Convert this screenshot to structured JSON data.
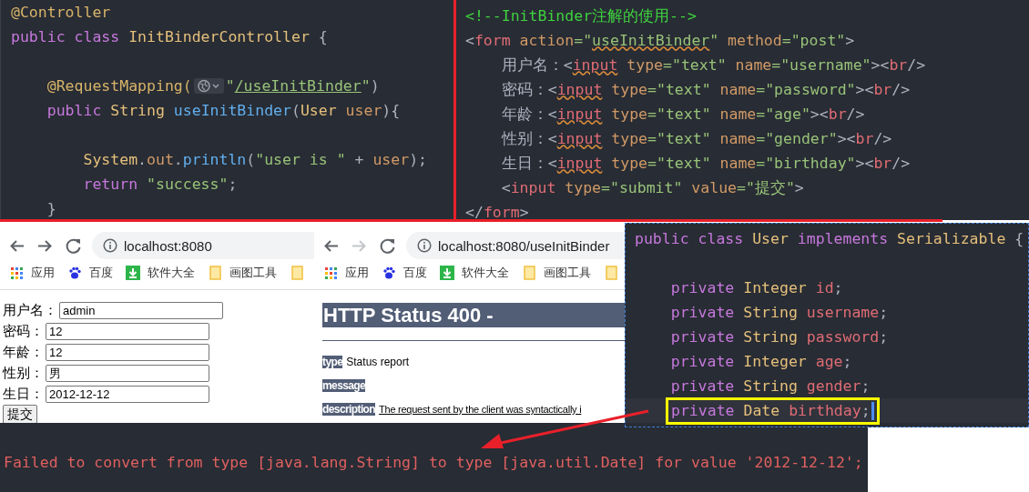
{
  "controller_code": {
    "lines": [
      {
        "tokens": [
          {
            "text": "@Controller",
            "kind": "ann"
          }
        ]
      },
      {
        "tokens": [
          {
            "text": "public",
            "kind": "kw"
          },
          {
            "text": " class",
            "kind": "kw"
          },
          {
            "text": " InitBinderController",
            "kind": "type"
          },
          {
            "text": " {",
            "kind": "plain"
          }
        ]
      },
      {
        "blank_before": true,
        "tokens": [
          {
            "text": "    @RequestMapping(",
            "kind": "ann",
            "inlay": true
          },
          {
            "text": "\"",
            "kind": "str"
          },
          {
            "text": "/useInitBinder",
            "kind": "url"
          },
          {
            "text": "\"",
            "kind": "str"
          },
          {
            "text": ")",
            "kind": "plain"
          }
        ]
      },
      {
        "tokens": [
          {
            "text": "    public",
            "kind": "kw"
          },
          {
            "text": " String",
            "kind": "type"
          },
          {
            "text": " useInitBinder",
            "kind": "method"
          },
          {
            "text": "(",
            "kind": "plain"
          },
          {
            "text": "User",
            "kind": "type"
          },
          {
            "text": " user",
            "kind": "param"
          },
          {
            "text": "){",
            "kind": "plain"
          }
        ]
      },
      {
        "blank_before": true,
        "tokens": [
          {
            "text": "        System",
            "kind": "type"
          },
          {
            "text": ".",
            "kind": "plain"
          },
          {
            "text": "out",
            "kind": "param"
          },
          {
            "text": ".",
            "kind": "plain"
          },
          {
            "text": "println",
            "kind": "method"
          },
          {
            "text": "(",
            "kind": "plain"
          },
          {
            "text": "\"user is \"",
            "kind": "str"
          },
          {
            "text": " + ",
            "kind": "plain"
          },
          {
            "text": "user",
            "kind": "param"
          },
          {
            "text": ");",
            "kind": "plain"
          }
        ]
      },
      {
        "tokens": [
          {
            "text": "        return",
            "kind": "kw"
          },
          {
            "text": " \"success\"",
            "kind": "str"
          },
          {
            "text": ";",
            "kind": "plain"
          }
        ]
      },
      {
        "tokens": [
          {
            "text": "    }",
            "kind": "plain"
          }
        ]
      }
    ]
  },
  "html_code": {
    "lines": [
      {
        "tokens": [
          {
            "text": "<!--InitBinder注解的使用-->",
            "kind": "comment"
          }
        ]
      },
      {
        "tokens": [
          {
            "text": "<",
            "kind": "punct"
          },
          {
            "text": "form",
            "kind": "tag"
          },
          {
            "text": " action",
            "kind": "attr"
          },
          {
            "text": "=\"",
            "kind": "value"
          },
          {
            "text": "useInitBinder",
            "kind": "value_typo"
          },
          {
            "text": "\"",
            "kind": "value"
          },
          {
            "text": " method",
            "kind": "attr"
          },
          {
            "text": "=\"post\"",
            "kind": "value"
          },
          {
            "text": ">",
            "kind": "punct"
          }
        ]
      },
      {
        "tokens": [
          {
            "text": "    用户名：",
            "kind": "plain"
          },
          {
            "text": "<",
            "kind": "punct"
          },
          {
            "text": "input",
            "kind": "tag_typo"
          },
          {
            "text": " type",
            "kind": "attr"
          },
          {
            "text": "=\"text\"",
            "kind": "value"
          },
          {
            "text": " name",
            "kind": "attr"
          },
          {
            "text": "=\"username\"",
            "kind": "value"
          },
          {
            "text": "><",
            "kind": "punct"
          },
          {
            "text": "br",
            "kind": "tag"
          },
          {
            "text": "/>",
            "kind": "punct"
          }
        ]
      },
      {
        "tokens": [
          {
            "text": "    密码：",
            "kind": "plain"
          },
          {
            "text": "<",
            "kind": "punct"
          },
          {
            "text": "input",
            "kind": "tag_typo"
          },
          {
            "text": " type",
            "kind": "attr"
          },
          {
            "text": "=\"text\"",
            "kind": "value"
          },
          {
            "text": " name",
            "kind": "attr"
          },
          {
            "text": "=\"password\"",
            "kind": "value"
          },
          {
            "text": "><",
            "kind": "punct"
          },
          {
            "text": "br",
            "kind": "tag"
          },
          {
            "text": "/>",
            "kind": "punct"
          }
        ]
      },
      {
        "tokens": [
          {
            "text": "    年龄：",
            "kind": "plain"
          },
          {
            "text": "<",
            "kind": "punct"
          },
          {
            "text": "input",
            "kind": "tag_typo"
          },
          {
            "text": " type",
            "kind": "attr"
          },
          {
            "text": "=\"text\"",
            "kind": "value"
          },
          {
            "text": " name",
            "kind": "attr"
          },
          {
            "text": "=\"age\"",
            "kind": "value"
          },
          {
            "text": "><",
            "kind": "punct"
          },
          {
            "text": "br",
            "kind": "tag"
          },
          {
            "text": "/>",
            "kind": "punct"
          }
        ]
      },
      {
        "tokens": [
          {
            "text": "    性别：",
            "kind": "plain"
          },
          {
            "text": "<",
            "kind": "punct"
          },
          {
            "text": "input",
            "kind": "tag_typo"
          },
          {
            "text": " type",
            "kind": "attr"
          },
          {
            "text": "=\"text\"",
            "kind": "value"
          },
          {
            "text": " name",
            "kind": "attr"
          },
          {
            "text": "=\"gender\"",
            "kind": "value"
          },
          {
            "text": "><",
            "kind": "punct"
          },
          {
            "text": "br",
            "kind": "tag"
          },
          {
            "text": "/>",
            "kind": "punct"
          }
        ]
      },
      {
        "tokens": [
          {
            "text": "    生日：",
            "kind": "plain"
          },
          {
            "text": "<",
            "kind": "punct"
          },
          {
            "text": "input",
            "kind": "tag_typo"
          },
          {
            "text": " type",
            "kind": "attr"
          },
          {
            "text": "=\"text\"",
            "kind": "value"
          },
          {
            "text": " name",
            "kind": "attr"
          },
          {
            "text": "=\"birthday\"",
            "kind": "value"
          },
          {
            "text": "><",
            "kind": "punct"
          },
          {
            "text": "br",
            "kind": "tag"
          },
          {
            "text": "/>",
            "kind": "punct"
          }
        ]
      },
      {
        "tokens": [
          {
            "text": "    <",
            "kind": "punct"
          },
          {
            "text": "input",
            "kind": "tag"
          },
          {
            "text": " type",
            "kind": "attr"
          },
          {
            "text": "=\"submit\"",
            "kind": "value"
          },
          {
            "text": " value",
            "kind": "attr"
          },
          {
            "text": "=\"提交\"",
            "kind": "value"
          },
          {
            "text": ">",
            "kind": "punct"
          }
        ]
      },
      {
        "tokens": [
          {
            "text": "</",
            "kind": "punct"
          },
          {
            "text": "form",
            "kind": "tag"
          },
          {
            "text": ">",
            "kind": "punct"
          }
        ]
      }
    ]
  },
  "browsers": [
    {
      "forward_disabled": false,
      "url": "localhost:8080",
      "bookmarks": [
        {
          "kind": "apps",
          "label": "应用"
        },
        {
          "kind": "paw",
          "label": "百度"
        },
        {
          "kind": "download",
          "label": "软件大全"
        },
        {
          "kind": "folder",
          "label": "画图工具"
        },
        {
          "kind": "folder"
        }
      ],
      "page": {
        "kind": "form",
        "fields": [
          {
            "label": "用户名：",
            "value": "admin"
          },
          {
            "label": "密码：",
            "value": "12"
          },
          {
            "label": "年龄：",
            "value": "12"
          },
          {
            "label": "性别：",
            "value": "男"
          },
          {
            "label": "生日：",
            "value": "2012-12-12"
          }
        ],
        "submit": "提交"
      }
    },
    {
      "forward_disabled": true,
      "url": "localhost:8080/useInitBinder",
      "bookmarks": [
        {
          "kind": "apps",
          "label": "应用"
        },
        {
          "kind": "paw",
          "label": "百度"
        },
        {
          "kind": "download",
          "label": "软件大全"
        },
        {
          "kind": "folder",
          "label": "画图工具"
        },
        {
          "kind": "folder"
        }
      ],
      "page": {
        "kind": "error",
        "heading": "HTTP Status 400 -",
        "entries": [
          {
            "label": "type",
            "text": "Status report"
          },
          {
            "label": "message"
          },
          {
            "label": "description",
            "text": "The request sent by the client was syntactically i"
          }
        ]
      }
    }
  ],
  "user_class": {
    "lines": [
      {
        "tokens": [
          {
            "text": "public",
            "kind": "kw"
          },
          {
            "text": " class",
            "kind": "kw"
          },
          {
            "text": " User",
            "kind": "type"
          },
          {
            "text": " implements",
            "kind": "kw"
          },
          {
            "text": " Serializable",
            "kind": "type"
          },
          {
            "text": " {",
            "kind": "plain"
          }
        ]
      },
      {
        "blank_before": true,
        "tokens": [
          {
            "text": "    private",
            "kind": "kw"
          },
          {
            "text": " Integer",
            "kind": "type"
          },
          {
            "text": " id",
            "kind": "field"
          },
          {
            "text": ";",
            "kind": "plain"
          }
        ]
      },
      {
        "tokens": [
          {
            "text": "    private",
            "kind": "kw"
          },
          {
            "text": " String",
            "kind": "type"
          },
          {
            "text": " username",
            "kind": "field"
          },
          {
            "text": ";",
            "kind": "plain"
          }
        ]
      },
      {
        "tokens": [
          {
            "text": "    private",
            "kind": "kw"
          },
          {
            "text": " String",
            "kind": "type"
          },
          {
            "text": " password",
            "kind": "field"
          },
          {
            "text": ";",
            "kind": "plain"
          }
        ]
      },
      {
        "tokens": [
          {
            "text": "    private",
            "kind": "kw"
          },
          {
            "text": " Integer",
            "kind": "type"
          },
          {
            "text": " age",
            "kind": "field"
          },
          {
            "text": ";",
            "kind": "plain"
          }
        ]
      },
      {
        "tokens": [
          {
            "text": "    private",
            "kind": "kw"
          },
          {
            "text": " String",
            "kind": "type"
          },
          {
            "text": " gender",
            "kind": "field"
          },
          {
            "text": ";",
            "kind": "plain"
          }
        ]
      },
      {
        "highlighted": true,
        "tokens": [
          {
            "text": "private",
            "kind": "kw"
          },
          {
            "text": " Date",
            "kind": "type"
          },
          {
            "text": " birthday",
            "kind": "field"
          },
          {
            "text": ";",
            "kind": "plain"
          }
        ]
      }
    ]
  },
  "console": {
    "text": "Failed to convert from type [java.lang.String] to type [java.util.Date] for value '2012-12-12';"
  }
}
